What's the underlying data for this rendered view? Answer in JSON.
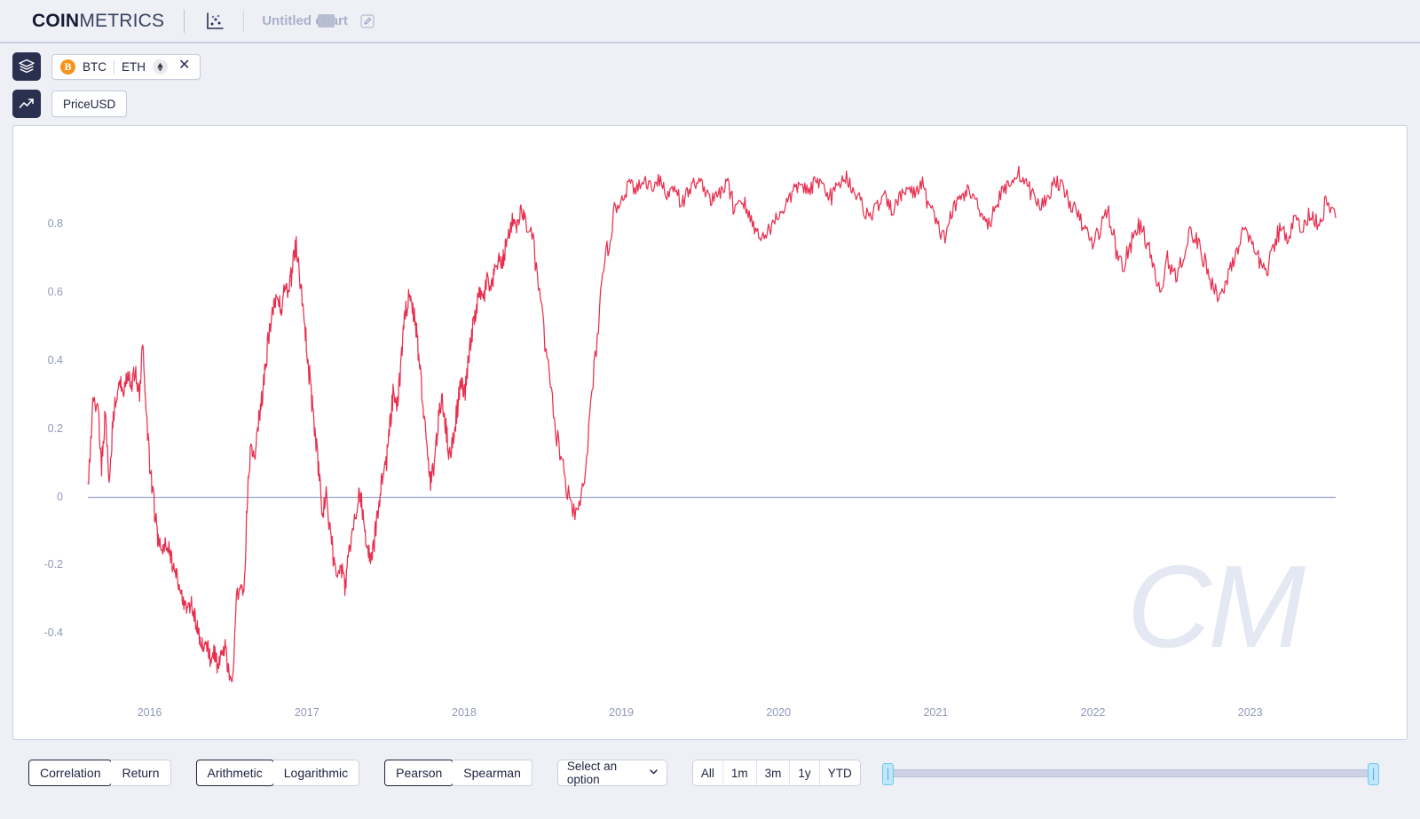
{
  "header": {
    "brand_bold": "COIN",
    "brand_light": "METRICS",
    "chart_type_icon": "scatter-plot-icon",
    "doc_title": "Untitled chart",
    "edit_icon": "pencil-edit-icon"
  },
  "toolbar": {
    "assets_icon": "layers-icon",
    "metric_icon": "trend-line-icon",
    "assets": [
      {
        "symbol": "BTC",
        "icon": "bitcoin-icon",
        "icon_glyph": "B"
      },
      {
        "symbol": "ETH",
        "icon": "ethereum-icon",
        "icon_glyph": "♦"
      }
    ],
    "remove_label": "✕",
    "metric": "PriceUSD"
  },
  "controls": {
    "mode": {
      "options": [
        "Correlation",
        "Return"
      ],
      "selected": "Correlation"
    },
    "scale": {
      "options": [
        "Arithmetic",
        "Logarithmic"
      ],
      "selected": "Arithmetic"
    },
    "method": {
      "options": [
        "Pearson",
        "Spearman"
      ],
      "selected": "Pearson"
    },
    "window_select": {
      "value": "Select an option",
      "chevron": "chevron-down-icon"
    },
    "ranges": {
      "options": [
        "All",
        "1m",
        "3m",
        "1y",
        "YTD"
      ],
      "selected": "All"
    },
    "slider": {
      "left_percent": 0,
      "right_percent": 100
    }
  },
  "chart_data": {
    "type": "line",
    "title": "",
    "xlabel": "",
    "ylabel": "",
    "watermark": "CM",
    "line_color": "#e8304f",
    "zero_line_color": "#9aa2c2",
    "grid": false,
    "legend": null,
    "xlim": [
      "2015-09",
      "2023-11"
    ],
    "ylim": [
      -0.55,
      1.0
    ],
    "yticks": [
      0.8,
      0.6,
      0.4,
      0.2,
      0,
      -0.2,
      -0.4
    ],
    "ytick_labels": [
      "0.8",
      "0.6",
      "0.4",
      "0.2",
      "0",
      "-0.2",
      "-0.4"
    ],
    "xticks": [
      "2016",
      "2017",
      "2018",
      "2019",
      "2020",
      "2021",
      "2022",
      "2023"
    ],
    "xtick_positions": [
      0.0495,
      0.1755,
      0.3015,
      0.4275,
      0.5535,
      0.6795,
      0.8055,
      0.9315
    ],
    "series": [
      {
        "name": "BTC vs ETH PriceUSD correlation",
        "color": "#e8304f",
        "x": [
          0.0,
          0.004,
          0.008,
          0.011,
          0.014,
          0.017,
          0.02,
          0.023,
          0.026,
          0.029,
          0.032,
          0.035,
          0.038,
          0.041,
          0.044,
          0.047,
          0.05,
          0.053,
          0.056,
          0.059,
          0.062,
          0.065,
          0.068,
          0.071,
          0.074,
          0.077,
          0.08,
          0.083,
          0.086,
          0.089,
          0.092,
          0.095,
          0.098,
          0.101,
          0.104,
          0.107,
          0.11,
          0.113,
          0.116,
          0.119,
          0.122,
          0.125,
          0.128,
          0.131,
          0.134,
          0.137,
          0.14,
          0.143,
          0.146,
          0.149,
          0.152,
          0.155,
          0.158,
          0.161,
          0.164,
          0.167,
          0.17,
          0.173,
          0.176,
          0.179,
          0.182,
          0.185,
          0.188,
          0.191,
          0.194,
          0.197,
          0.2,
          0.203,
          0.206,
          0.209,
          0.212,
          0.215,
          0.218,
          0.221,
          0.224,
          0.227,
          0.23,
          0.233,
          0.236,
          0.239,
          0.242,
          0.245,
          0.248,
          0.251,
          0.254,
          0.257,
          0.26,
          0.263,
          0.266,
          0.269,
          0.272,
          0.275,
          0.278,
          0.281,
          0.284,
          0.287,
          0.29,
          0.293,
          0.296,
          0.299,
          0.302,
          0.305,
          0.308,
          0.311,
          0.314,
          0.317,
          0.32,
          0.323,
          0.326,
          0.329,
          0.332,
          0.335,
          0.338,
          0.341,
          0.344,
          0.347,
          0.35,
          0.356,
          0.362,
          0.368,
          0.374,
          0.38,
          0.386,
          0.392,
          0.398,
          0.404,
          0.41,
          0.416,
          0.422,
          0.428,
          0.434,
          0.44,
          0.446,
          0.452,
          0.458,
          0.464,
          0.47,
          0.476,
          0.482,
          0.488,
          0.494,
          0.5,
          0.506,
          0.512,
          0.518,
          0.524,
          0.53,
          0.536,
          0.542,
          0.548,
          0.554,
          0.56,
          0.566,
          0.572,
          0.578,
          0.584,
          0.59,
          0.596,
          0.602,
          0.608,
          0.614,
          0.62,
          0.626,
          0.632,
          0.638,
          0.644,
          0.65,
          0.656,
          0.662,
          0.668,
          0.674,
          0.68,
          0.686,
          0.692,
          0.698,
          0.704,
          0.71,
          0.716,
          0.722,
          0.728,
          0.734,
          0.74,
          0.746,
          0.752,
          0.758,
          0.764,
          0.77,
          0.776,
          0.782,
          0.788,
          0.794,
          0.8,
          0.806,
          0.812,
          0.818,
          0.824,
          0.83,
          0.836,
          0.842,
          0.848,
          0.854,
          0.86,
          0.866,
          0.872,
          0.878,
          0.884,
          0.89,
          0.896,
          0.902,
          0.908,
          0.914,
          0.92,
          0.926,
          0.932,
          0.938,
          0.944,
          0.95,
          0.956,
          0.962,
          0.968,
          0.974,
          0.98,
          0.986,
          0.992,
          1.0
        ],
        "y": [
          0.02,
          0.28,
          0.26,
          0.1,
          0.24,
          0.04,
          0.22,
          0.3,
          0.34,
          0.31,
          0.36,
          0.33,
          0.38,
          0.3,
          0.43,
          0.24,
          0.08,
          -0.02,
          -0.12,
          -0.16,
          -0.13,
          -0.15,
          -0.2,
          -0.23,
          -0.27,
          -0.31,
          -0.34,
          -0.3,
          -0.36,
          -0.4,
          -0.44,
          -0.42,
          -0.48,
          -0.45,
          -0.5,
          -0.46,
          -0.44,
          -0.51,
          -0.55,
          -0.3,
          -0.26,
          -0.28,
          0.01,
          0.16,
          0.1,
          0.22,
          0.3,
          0.41,
          0.5,
          0.56,
          0.6,
          0.54,
          0.62,
          0.59,
          0.68,
          0.74,
          0.62,
          0.55,
          0.42,
          0.3,
          0.18,
          0.08,
          -0.05,
          0.0,
          -0.1,
          -0.18,
          -0.24,
          -0.2,
          -0.26,
          -0.16,
          -0.1,
          -0.05,
          0.02,
          -0.08,
          -0.14,
          -0.2,
          -0.12,
          -0.02,
          0.06,
          0.1,
          0.2,
          0.31,
          0.26,
          0.4,
          0.52,
          0.6,
          0.56,
          0.5,
          0.38,
          0.26,
          0.12,
          0.04,
          0.12,
          0.22,
          0.3,
          0.2,
          0.12,
          0.18,
          0.26,
          0.34,
          0.3,
          0.4,
          0.48,
          0.55,
          0.6,
          0.58,
          0.64,
          0.6,
          0.66,
          0.7,
          0.68,
          0.74,
          0.78,
          0.82,
          0.79,
          0.84,
          0.82,
          0.76,
          0.6,
          0.4,
          0.22,
          0.1,
          -0.02,
          -0.06,
          0.05,
          0.3,
          0.55,
          0.72,
          0.84,
          0.88,
          0.92,
          0.9,
          0.93,
          0.91,
          0.94,
          0.88,
          0.92,
          0.86,
          0.9,
          0.93,
          0.91,
          0.87,
          0.89,
          0.92,
          0.85,
          0.88,
          0.82,
          0.78,
          0.76,
          0.8,
          0.83,
          0.86,
          0.9,
          0.92,
          0.89,
          0.93,
          0.91,
          0.88,
          0.92,
          0.94,
          0.9,
          0.86,
          0.82,
          0.85,
          0.88,
          0.84,
          0.87,
          0.91,
          0.89,
          0.92,
          0.86,
          0.8,
          0.76,
          0.83,
          0.87,
          0.9,
          0.88,
          0.84,
          0.8,
          0.86,
          0.9,
          0.93,
          0.95,
          0.92,
          0.88,
          0.85,
          0.89,
          0.93,
          0.9,
          0.86,
          0.82,
          0.78,
          0.74,
          0.8,
          0.84,
          0.72,
          0.68,
          0.74,
          0.8,
          0.76,
          0.66,
          0.6,
          0.7,
          0.64,
          0.72,
          0.78,
          0.74,
          0.68,
          0.62,
          0.58,
          0.66,
          0.72,
          0.78,
          0.74,
          0.7,
          0.66,
          0.72,
          0.8,
          0.76,
          0.82,
          0.78,
          0.84,
          0.8,
          0.86,
          0.82,
          0.88,
          0.84,
          0.9,
          0.86,
          0.92,
          0.88,
          0.94,
          0.9,
          0.86,
          0.92,
          0.96,
          0.93,
          0.9,
          0.94,
          0.88,
          0.84,
          0.9,
          0.93,
          0.91,
          0.95
        ]
      }
    ]
  }
}
